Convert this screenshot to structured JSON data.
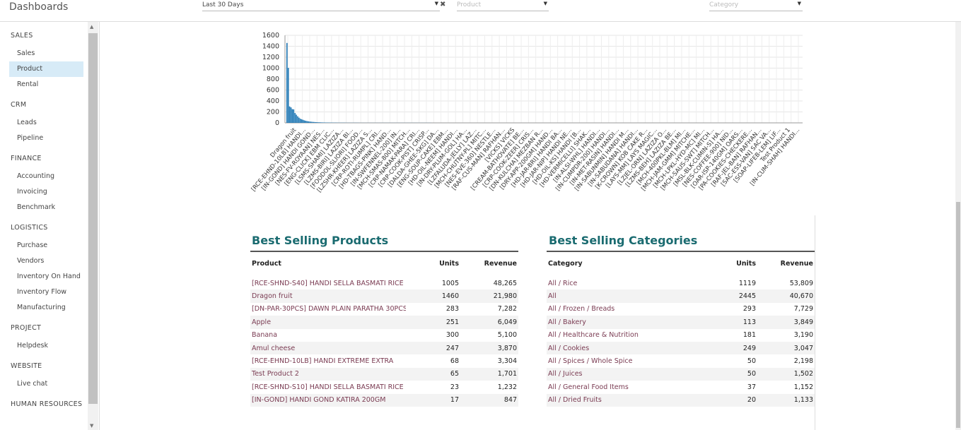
{
  "app_title": "Dashboards",
  "filters": {
    "period": "Last 30 Days",
    "product_placeholder": "Product",
    "category_placeholder": "Category",
    "clear_symbol": "✖"
  },
  "sidebar": [
    {
      "group": "SALES",
      "items": [
        "Sales",
        "Product",
        "Rental"
      ]
    },
    {
      "group": "CRM",
      "items": [
        "Leads",
        "Pipeline"
      ]
    },
    {
      "group": "FINANCE",
      "items": [
        "Accounting",
        "Invoicing",
        "Benchmark"
      ]
    },
    {
      "group": "LOGISTICS",
      "items": [
        "Purchase",
        "Vendors",
        "Inventory On Hand",
        "Inventory Flow",
        "Manufacturing"
      ]
    },
    {
      "group": "PROJECT",
      "items": [
        "Helpdesk"
      ]
    },
    {
      "group": "WEBSITE",
      "items": [
        "Live chat"
      ]
    },
    {
      "group": "HUMAN RESOURCES",
      "items": []
    }
  ],
  "active_item": "Product",
  "chart_data": {
    "type": "bar",
    "title": "",
    "xlabel": "",
    "ylabel": "",
    "ylim": [
      0,
      1600
    ],
    "yticks": [
      0,
      200,
      400,
      600,
      800,
      1000,
      1200,
      1400,
      1600
    ],
    "grid": true,
    "color": "#1f77b4",
    "tick_labels": [
      "Dragon fruit",
      "[RCE-EHND-10LB] HANDI...",
      "[IN-GOND] HANDI GOND...",
      "[NES-FV-ROYAAN] NES...",
      "[ENG-CLICK] EBM CLIC...",
      "[LSMS-SHAMI] LAZIZA...",
      "[LZMS-BIRI] LAZIZA BI...",
      "[FOODOL-SLIORI] FOOD...",
      "[LZSHR-KHEER] LAZIZA S...",
      "[CRP-ROTI-RUMPL] CRI...",
      "[HD-TBAGS-PINK] HAND...",
      "[IN-SWFENNEL-200] IN...",
      "[MCH-SMAS-800] MITCH...",
      "[CRP-NAMAK-PARA] CRI...",
      "[CRP-COOK-PIST] CRISP...",
      "[DALDA-GHEE-5KG] DA...",
      "[ENG-SOUP-CAKE] EBM...",
      "[HD-OIL-NEEM] HANDI...",
      "[IN-DRY-PLUM-GOL] HA...",
      "[LZFALUDA-JELLY] LAZ...",
      "[MCH-CHUTNY-PL] MITC...",
      "[NES-EVE-360] NESTLE...",
      "[RAF-CUS-MAN] RAFHAN...",
      "[VICKS] VICKS",
      "[CREAM-BATHOVATE] BE...",
      "[CRP-COOK-ZEER] CRIS...",
      "[DN-KULCHA] MEZBAN R...",
      "[DRY-APP-200GM] HAND...",
      "[HD-JAR-BRI] HANDI BA...",
      "[HD-JAR-NIP] HANDI NE...",
      "[HD-OIL-KS] HANDI [B...",
      "[HD-VERMICELLI] SHAK...",
      "[IN-ALSI-WHL] HANDI...",
      "[IN-CUMPDR-200] HANDI...",
      "[IN-MET-RASIN] HANDI...",
      "[IN-SABUNMIN] HANDI M...",
      "[IN-SABUDANA] HANDI...",
      "[K-CROWN] KOB CAKE R...",
      "[LAYS-MM] LAYS MAGIC...",
      "[LZJEL-ORN] LAZIZA O...",
      "[LZMS-BEH] LAZIZA BE...",
      "[MCH-400PKL-BLM] MI...",
      "[MCH-JAM-GMM] MITCHE...",
      "[MCH-LPKL-HYD-MC] MI...",
      "[MCH-SAUS-SWT] MITCH...",
      "[MSL-BLK-CUMIN-S] HA...",
      "[NES-COFFEE-900] NID...",
      "[OAR-ISP-140GM] OARS...",
      "[PA-COOKIES-CHECKERE...",
      "[RAF-JEL-BAN] RAFHAN...",
      "[SAC-ESS-VAN] SAC VA...",
      "[SOAP-LIFEB-LEM] LIF...",
      "Test Product 1",
      "[IN-CUM-SHAH] HANDI..."
    ],
    "values": [
      1460,
      1005,
      300,
      283,
      251,
      247,
      180,
      150,
      120,
      95,
      75,
      65,
      55,
      45,
      38,
      32,
      28,
      24,
      21,
      18,
      16,
      14,
      12,
      11,
      10,
      9,
      8,
      7,
      7,
      6,
      6,
      5,
      5,
      5,
      4,
      4,
      4,
      4,
      3,
      3,
      3,
      3,
      3,
      3,
      2,
      2,
      2,
      2,
      2,
      2,
      2,
      2,
      2,
      2,
      1,
      1,
      1,
      1,
      1,
      1,
      1,
      1,
      1,
      1,
      1,
      1,
      1,
      1,
      1,
      1,
      1,
      1,
      1,
      1,
      1,
      1,
      1,
      1,
      1,
      1,
      1,
      1,
      1,
      1,
      1,
      1,
      1,
      1,
      1,
      1,
      1,
      1,
      1,
      1,
      1,
      1,
      1,
      1,
      1,
      1,
      1,
      1,
      1,
      1,
      1,
      1,
      1,
      1
    ]
  },
  "best_products": {
    "title": "Best Selling Products",
    "headers": [
      "Product",
      "Units",
      "Revenue"
    ],
    "rows": [
      [
        "[RCE-SHND-S40] HANDI SELLA BASMATI RICE",
        "1005",
        "48,265"
      ],
      [
        "Dragon fruit",
        "1460",
        "21,980"
      ],
      [
        "[DN-PAR-30PCS] DAWN PLAIN PARATHA 30PCS",
        "283",
        "7,282"
      ],
      [
        "Apple",
        "251",
        "6,049"
      ],
      [
        "Banana",
        "300",
        "5,100"
      ],
      [
        "Amul cheese",
        "247",
        "3,870"
      ],
      [
        "[RCE-EHND-10LB] HANDI EXTREME EXTRA",
        "68",
        "3,304"
      ],
      [
        "Test Product 2",
        "65",
        "1,701"
      ],
      [
        "[RCE-SHND-S10] HANDI SELLA BASMATI RICE",
        "23",
        "1,232"
      ],
      [
        "[IN-GOND] HANDI GOND KATIRA 200GM",
        "17",
        "847"
      ]
    ]
  },
  "best_categories": {
    "title": "Best Selling Categories",
    "headers": [
      "Category",
      "Units",
      "Revenue"
    ],
    "rows": [
      [
        "All / Rice",
        "1119",
        "53,809"
      ],
      [
        "All",
        "2445",
        "40,670"
      ],
      [
        "All / Frozen / Breads",
        "293",
        "7,729"
      ],
      [
        "All / Bakery",
        "113",
        "3,849"
      ],
      [
        "All / Healthcare & Nutrition",
        "181",
        "3,190"
      ],
      [
        "All / Cookies",
        "249",
        "3,047"
      ],
      [
        "All / Spices / Whole Spice",
        "50",
        "2,198"
      ],
      [
        "All / Juices",
        "50",
        "1,502"
      ],
      [
        "All / General Food Items",
        "37",
        "1,152"
      ],
      [
        "All / Dried Fruits",
        "20",
        "1,133"
      ]
    ]
  }
}
